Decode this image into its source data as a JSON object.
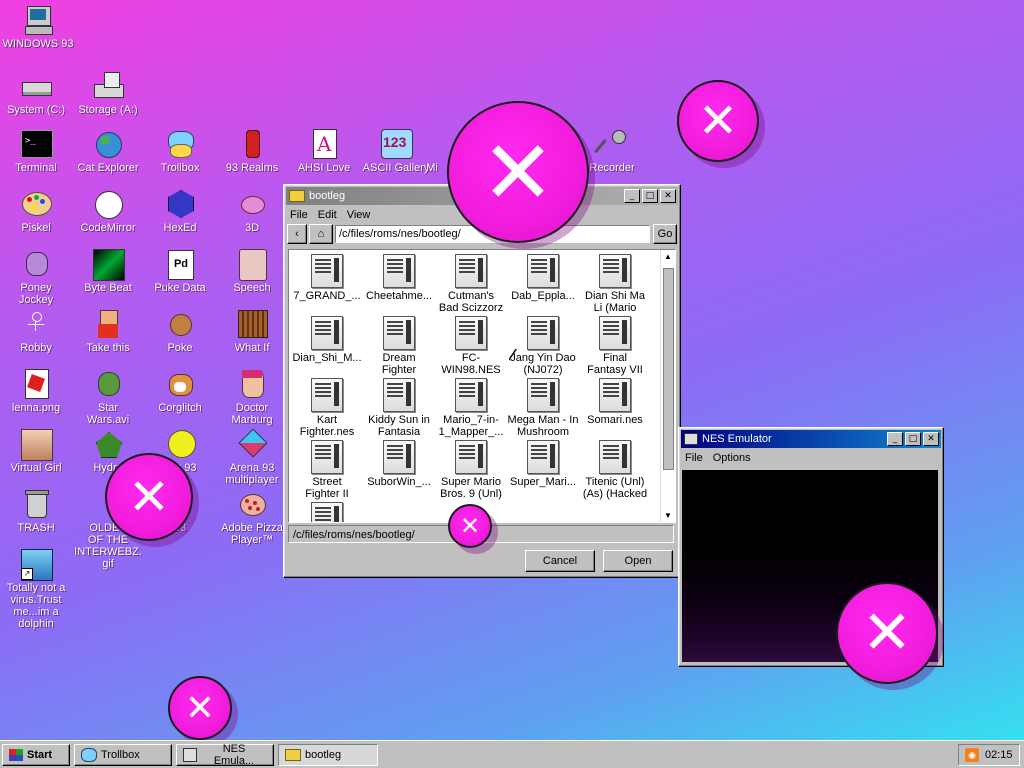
{
  "desktop": {
    "icons": [
      {
        "label": "WINDOWS 93",
        "icon": "computer-icon"
      },
      {
        "label": "System (C:)",
        "icon": "drive-icon"
      },
      {
        "label": "Storage (A:)",
        "icon": "floppy-drive-icon"
      },
      {
        "label": "Terminal",
        "icon": "terminal-icon"
      },
      {
        "label": "Cat Explorer",
        "icon": "cat-explorer-icon"
      },
      {
        "label": "Trollbox",
        "icon": "trollbox-icon"
      },
      {
        "label": "93 Realms",
        "icon": "realms-icon"
      },
      {
        "label": "AHSI Love",
        "icon": "ahsi-icon"
      },
      {
        "label": "ASCII Gallery",
        "icon": "ascii-gallery-icon"
      },
      {
        "label": "Mi",
        "icon": "music-icon"
      },
      {
        "label": "Recorder",
        "icon": "microphone-icon"
      },
      {
        "label": "Piskel",
        "icon": "palette-icon"
      },
      {
        "label": "CodeMirror",
        "icon": "codemirror-icon"
      },
      {
        "label": "HexEd",
        "icon": "hexed-icon"
      },
      {
        "label": "3D",
        "icon": "teapot-icon"
      },
      {
        "label": "Poney\nJockey",
        "icon": "pony-icon"
      },
      {
        "label": "Byte Beat",
        "icon": "bytebeat-icon"
      },
      {
        "label": "Puke Data",
        "icon": "puke-data-icon"
      },
      {
        "label": "Speech",
        "icon": "speech-icon"
      },
      {
        "label": "Robby",
        "icon": "robot-icon"
      },
      {
        "label": "Take this",
        "icon": "take-this-icon"
      },
      {
        "label": "Poke",
        "icon": "poke-icon"
      },
      {
        "label": "What If",
        "icon": "what-if-icon"
      },
      {
        "label": "lenna.png",
        "icon": "image-file-icon"
      },
      {
        "label": "Star\nWars.avi",
        "icon": "yoda-icon"
      },
      {
        "label": "Corglitch",
        "icon": "corgi-icon"
      },
      {
        "label": "Doctor\nMarburg",
        "icon": "doctor-icon"
      },
      {
        "label": "Virtual Girl",
        "icon": "virtual-girl-icon"
      },
      {
        "label": "Hydra",
        "icon": "hydra-icon"
      },
      {
        "label": "box 93",
        "icon": "smiley-icon"
      },
      {
        "label": "Arena 93\nmultiplayer",
        "icon": "cube-icon"
      },
      {
        "label": "TRASH",
        "icon": "trash-icon"
      },
      {
        "label": "OLDES\nOF THE\nINTERWEBZ.\ngif",
        "icon": "gif-icon"
      },
      {
        "label": "93",
        "icon": "partial-icon"
      },
      {
        "label": "Adobe Pizza\nPlayer™",
        "icon": "pizza-icon"
      },
      {
        "label": "Totally not a\nvirus.Trust\nme...im a\ndolphin",
        "icon": "dolphin-icon"
      }
    ]
  },
  "explorer": {
    "title": "bootleg",
    "menu": [
      "File",
      "Edit",
      "View"
    ],
    "path": "/c/files/roms/nes/bootleg/",
    "go_label": "Go",
    "status_path": "/c/files/roms/nes/bootleg/",
    "cancel_label": "Cancel",
    "open_label": "Open",
    "files": [
      "7_GRAND_...",
      "Cheetahme...",
      "Cutman's\nBad Scizzorz",
      "Dab_Eppla...",
      "Dian Shi Ma\nLi (Mario",
      "Dian_Shi_M...",
      "Dream\nFighter",
      "FC-\nWIN98.NES",
      "Jang Yin Dao\n(NJ072)",
      "Final\nFantasy VII",
      "Kart\nFighter.nes",
      "Kiddy Sun in\nFantasia",
      "Mario_7-in-\n1_Mapper_...",
      "Mega Man - In\nMushroom",
      "Somari.nes",
      "Street\nFighter II",
      "SuborWin_...",
      "Super Mario\nBros. 9 (Unl)",
      "Super_Mari...",
      "Titenic (Unl)\n(As) (Hacked"
    ]
  },
  "nes": {
    "title": "NES Emulator",
    "menu": [
      "File",
      "Options"
    ]
  },
  "taskbar": {
    "start": "Start",
    "tasks": [
      "Trollbox",
      "NES Emula...",
      "bootleg"
    ],
    "clock": "02:15"
  },
  "colors": {
    "accent": "#f21cdc",
    "titlebar_active": "#000080"
  }
}
